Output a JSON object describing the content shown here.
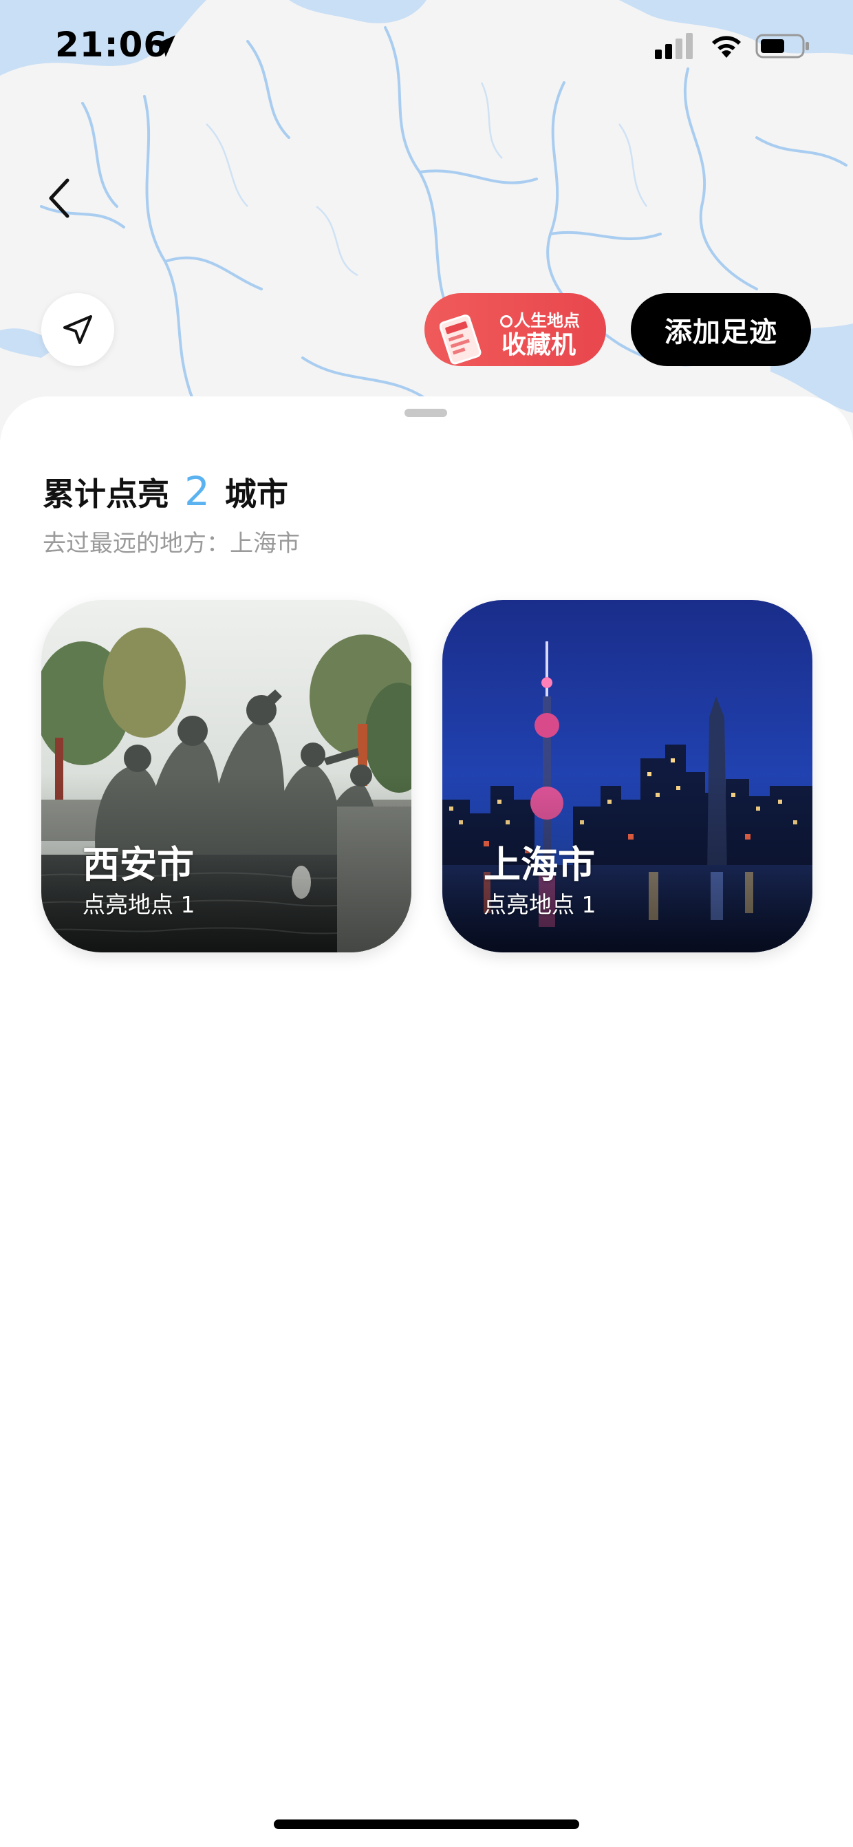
{
  "status_bar": {
    "time": "21:06",
    "icons": [
      "location-arrow-icon",
      "signal-icon",
      "wifi-icon",
      "battery-icon"
    ]
  },
  "map": {
    "land_color": "#f4f4f4",
    "water_color": "#c9dff5",
    "river_color": "#a9cdf0"
  },
  "controls": {
    "back_icon": "chevron-left-icon",
    "locate_icon": "navigation-arrow-icon",
    "collector": {
      "line1": "人生地点",
      "line2": "收藏机",
      "color": "#ec5050"
    },
    "add_footprint_label": "添加足迹"
  },
  "summary": {
    "prefix": "累计点亮",
    "count": "2",
    "suffix": "城市",
    "farthest": "去过最远的地方：上海市",
    "count_color": "#5ab2f0"
  },
  "cities": [
    {
      "name": "西安市",
      "subtitle": "点亮地点 1",
      "photo": "sculpture-fountain-photo"
    },
    {
      "name": "上海市",
      "subtitle": "点亮地点 1",
      "photo": "shanghai-skyline-night-photo"
    }
  ]
}
